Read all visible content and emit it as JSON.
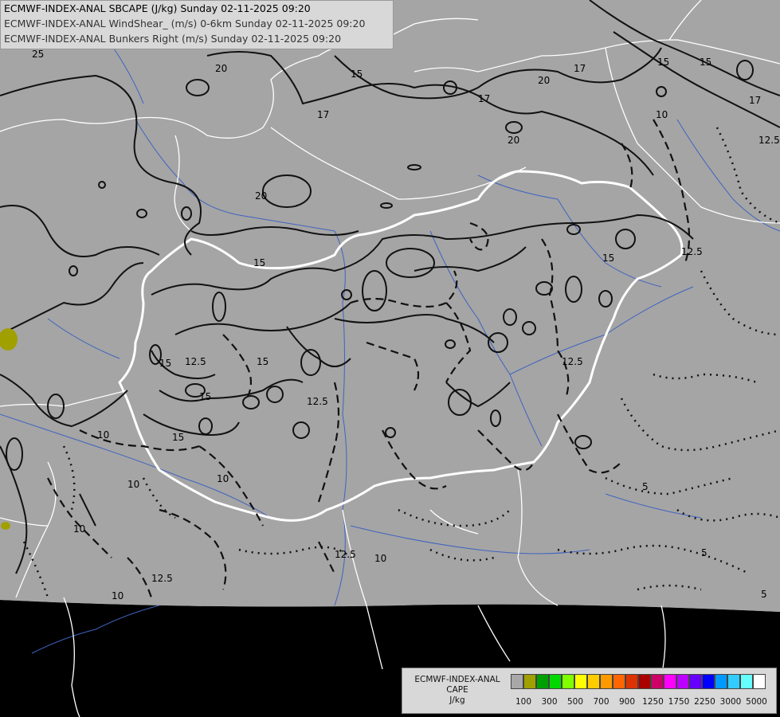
{
  "header": {
    "lines": [
      "ECMWF-INDEX-ANAL SBCAPE (J/kg) Sunday 02-11-2025 09:20",
      "ECMWF-INDEX-ANAL WindShear_ (m/s) 0-6km Sunday 02-11-2025 09:20",
      "ECMWF-INDEX-ANAL Bunkers Right (m/s) Sunday 02-11-2025 09:20"
    ]
  },
  "legend": {
    "title_lines": [
      "ECMWF-INDEX-ANAL",
      "CAPE",
      "J/kg"
    ],
    "colors": [
      "#a8a8a8",
      "#a0a000",
      "#00a000",
      "#00d800",
      "#80ff00",
      "#ffff00",
      "#ffcc00",
      "#ff9900",
      "#ff6600",
      "#dd3300",
      "#aa0000",
      "#cc0066",
      "#ff00ff",
      "#bb00ff",
      "#6600ff",
      "#0000ff",
      "#0099ff",
      "#33ccff",
      "#66ffff",
      "#ffffff"
    ],
    "tick_labels": [
      "100",
      "300",
      "500",
      "700",
      "900",
      "1250",
      "1750",
      "2250",
      "3000",
      "5000"
    ]
  },
  "contour_labels": {
    "windshear": [
      "25",
      "20",
      "15",
      "17",
      "20",
      "17",
      "20",
      "15",
      "17",
      "17",
      "20",
      "15",
      "15",
      "15",
      "15",
      "15",
      "15",
      "15"
    ],
    "bunkers": [
      "10",
      "12.5",
      "12.5",
      "12.5",
      "12.5",
      "12.5",
      "10",
      "10",
      "10",
      "12.5",
      "10",
      "12.5",
      "10",
      "10",
      "5",
      "5",
      "5",
      "10",
      "12.5"
    ]
  },
  "colors": {
    "background": "#000000",
    "map_fill": "#a5a5a5",
    "borders": "#ffffff",
    "rivers": "#3f63c0",
    "cape_low": "#a0a000"
  }
}
